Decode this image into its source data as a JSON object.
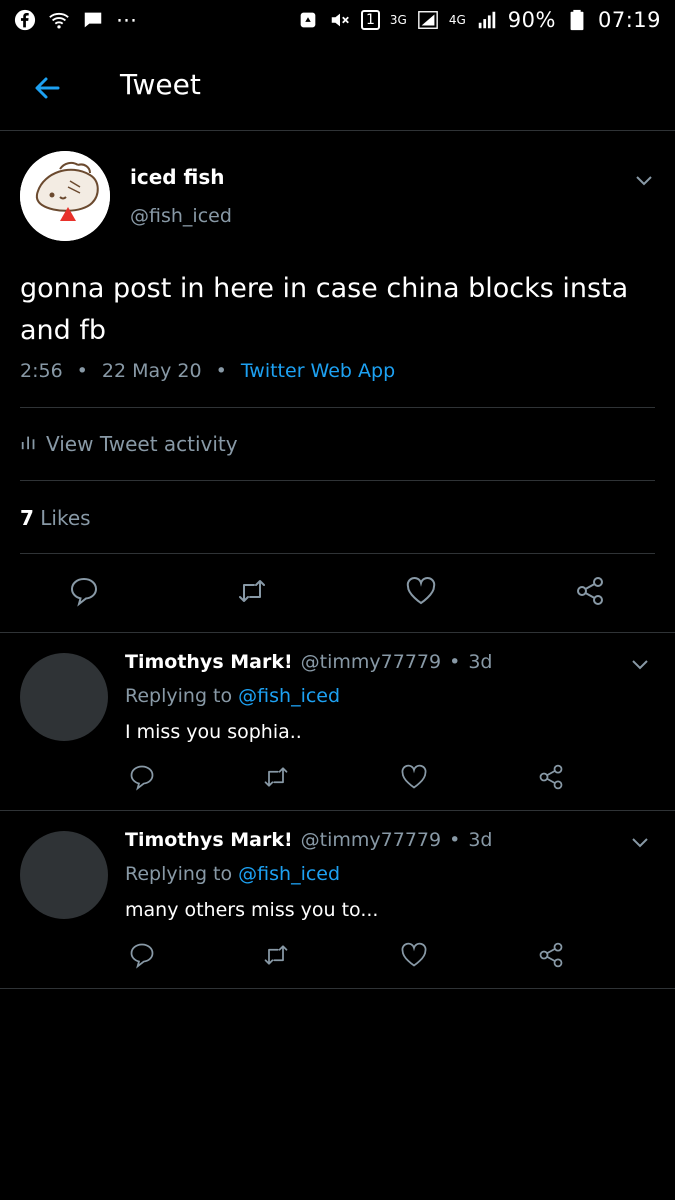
{
  "status_bar": {
    "battery": "90%",
    "time": "07:19",
    "net_1": "3G",
    "net_2": "4G",
    "sim": "1"
  },
  "header": {
    "title": "Tweet"
  },
  "tweet": {
    "author_name": "iced fish",
    "author_handle": "@fish_iced",
    "text": "gonna post in here in case china blocks insta and fb",
    "time": "2:56",
    "date": "22 May 20",
    "source": "Twitter Web App",
    "activity_label": "View Tweet activity",
    "likes_count": "7",
    "likes_label": "Likes"
  },
  "replies": [
    {
      "name": "Timothys Mark!",
      "handle": "@timmy77779",
      "age": "3d",
      "replying_label": "Replying to",
      "replying_handle": "@fish_iced",
      "text": "I miss you sophia.."
    },
    {
      "name": "Timothys Mark!",
      "handle": "@timmy77779",
      "age": "3d",
      "replying_label": "Replying to",
      "replying_handle": "@fish_iced",
      "text": "many others miss you to..."
    }
  ],
  "colors": {
    "accent": "#1da1f2",
    "muted": "#8899a6",
    "divider": "#2f3336",
    "background": "#000000"
  }
}
